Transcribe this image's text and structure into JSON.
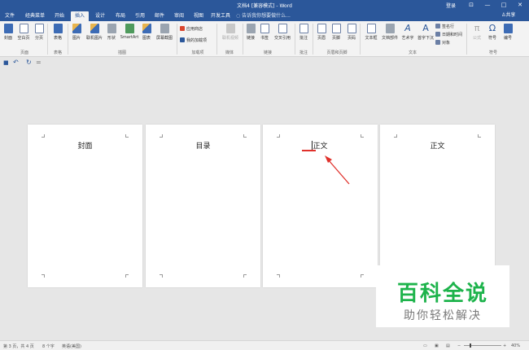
{
  "window": {
    "title": "文档4 [兼容模式] - Word",
    "login_label": "登录",
    "min_glyph": "—",
    "max_glyph": "□",
    "close_glyph": "✕",
    "restore_glyph": "⊡"
  },
  "tabs": [
    "文件",
    "经典菜单",
    "开始",
    "插入",
    "设计",
    "布局",
    "引用",
    "邮件",
    "审阅",
    "视图",
    "开发工具"
  ],
  "active_tab": "插入",
  "tell_me": "告诉我你想要做什么...",
  "share_label": "共享",
  "ribbon": {
    "buttons": [
      "封面",
      "空白页",
      "分页",
      "表格",
      "图片",
      "联机图片",
      "形状",
      "SmartArt",
      "图表",
      "屏幕截图",
      "联机视频",
      "链接",
      "书签",
      "交叉引用",
      "批注",
      "页眉",
      "页脚",
      "页码",
      "文本框",
      "文档部件",
      "艺术字",
      "首字下沉",
      "公式",
      "符号",
      "编号"
    ],
    "addin_store": "应用商店",
    "my_addins": "我的加载项",
    "signature_line": "签名行",
    "date_time": "日期和时间",
    "object": "对象",
    "groups": [
      "页面",
      "表格",
      "插图",
      "加载项",
      "媒体",
      "链接",
      "批注",
      "页眉和页脚",
      "文本",
      "符号"
    ],
    "glyphs": {
      "omega": "Ω",
      "pi": "π",
      "wordart": "A",
      "dropcap": "A"
    }
  },
  "qat": {
    "save_glyph": "■",
    "undo_glyph": "↶",
    "redo_glyph": "↻",
    "more_glyph": "="
  },
  "pages": [
    {
      "heading": "封面"
    },
    {
      "heading": "目录"
    },
    {
      "heading": "正文"
    },
    {
      "heading": "正文"
    }
  ],
  "watermark": {
    "title": "百科全说",
    "subtitle": "助你轻松解决"
  },
  "status": {
    "page_info": "第 3 页，共 4 页",
    "word_count": "8 个字",
    "language": "英语(美国)",
    "zoom": "40%"
  },
  "colors": {
    "accent": "#2b579a",
    "annotation": "#e0312b",
    "watermark_green": "#1db34b"
  }
}
